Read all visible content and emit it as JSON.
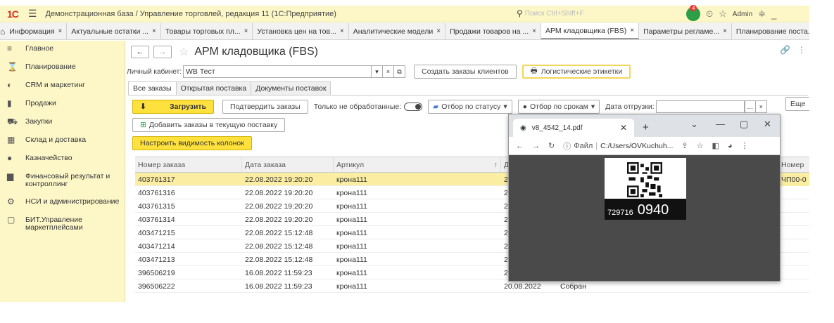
{
  "titlebar": {
    "logo": "1С",
    "title": "Демонстрационная база / Управление торговлей, редакция 11  (1С:Предприятие)",
    "search_placeholder": "Поиск Ctrl+Shift+F",
    "badge_count": "4",
    "user": "Admin"
  },
  "tabs": [
    {
      "label": "Информация",
      "close": "×"
    },
    {
      "label": "Актуальные остатки ...",
      "close": "×"
    },
    {
      "label": "Товары торговых пл...",
      "close": "×"
    },
    {
      "label": "Установка цен на тов...",
      "close": "×"
    },
    {
      "label": "Аналитические модели",
      "close": "×"
    },
    {
      "label": "Продажи товаров на ...",
      "close": "×"
    },
    {
      "label": "АРМ кладовщика (FBS)",
      "close": "×"
    },
    {
      "label": "Параметры регламе...",
      "close": "×"
    },
    {
      "label": "Планирование поста...",
      "close": ""
    }
  ],
  "sidebar": [
    {
      "label": "Главное",
      "icon": "≡"
    },
    {
      "label": "Планирование",
      "icon": "⌛"
    },
    {
      "label": "CRM и маркетинг",
      "icon": "◐"
    },
    {
      "label": "Продажи",
      "icon": "▮"
    },
    {
      "label": "Закупки",
      "icon": "⛟"
    },
    {
      "label": "Склад и доставка",
      "icon": "▦"
    },
    {
      "label": "Казначейство",
      "icon": "●"
    },
    {
      "label": "Финансовый результат и контроллинг",
      "icon": "▆"
    },
    {
      "label": "НСИ и администрирование",
      "icon": "⚙"
    },
    {
      "label": "БИТ.Управление маркетплейсами",
      "icon": "▢"
    }
  ],
  "main": {
    "title": "АРМ кладовщика (FBS)",
    "cabinet_label": "Личный кабинет:",
    "cabinet_value": "WB Тест",
    "create_orders_btn": "Создать заказы клиентов",
    "logistic_labels_btn": "Логистические этикетки",
    "subtabs": [
      "Все заказы",
      "Открытая поставка",
      "Документы поставок"
    ],
    "load_btn": "Загрузить",
    "confirm_btn": "Подтвердить заказы",
    "only_unprocessed": "Только не обработанные:",
    "status_filter": "Отбор по статусу",
    "term_filter": "Отбор по срокам",
    "ship_date_label": "Дата отгрузки:",
    "add_orders_btn": "Добавить заказы в текущую поставку",
    "columns_btn": "Настроить видимость колонок",
    "more_btn": "Еще"
  },
  "grid": {
    "headers": [
      "Номер заказа",
      "Дата заказа",
      "Артикул",
      "Д"
    ],
    "right_header": "Номер",
    "right_first_cell": "ЧП00-0",
    "rows": [
      [
        "403761317",
        "22.08.2022 19:20:20",
        "крона111",
        "2",
        ""
      ],
      [
        "403761316",
        "22.08.2022 19:20:20",
        "крона111",
        "2",
        ""
      ],
      [
        "403761315",
        "22.08.2022 19:20:20",
        "крона111",
        "2",
        ""
      ],
      [
        "403761314",
        "22.08.2022 19:20:20",
        "крона111",
        "2",
        ""
      ],
      [
        "403471215",
        "22.08.2022 15:12:48",
        "крона111",
        "2",
        ""
      ],
      [
        "403471214",
        "22.08.2022 15:12:48",
        "крона111",
        "2",
        ""
      ],
      [
        "403471213",
        "22.08.2022 15:12:48",
        "крона111",
        "2",
        ""
      ],
      [
        "396506219",
        "16.08.2022 11:59:23",
        "крона111",
        "2",
        ""
      ],
      [
        "396506222",
        "16.08.2022 11:59:23",
        "крона111",
        "20.08.2022",
        "Собран"
      ]
    ]
  },
  "popup": {
    "tab_title": "v8_4542_14.pdf",
    "address_label": "Файл",
    "address": "C:/Users/OVKuchuh...",
    "label_small": "729716",
    "label_big": "0940"
  }
}
